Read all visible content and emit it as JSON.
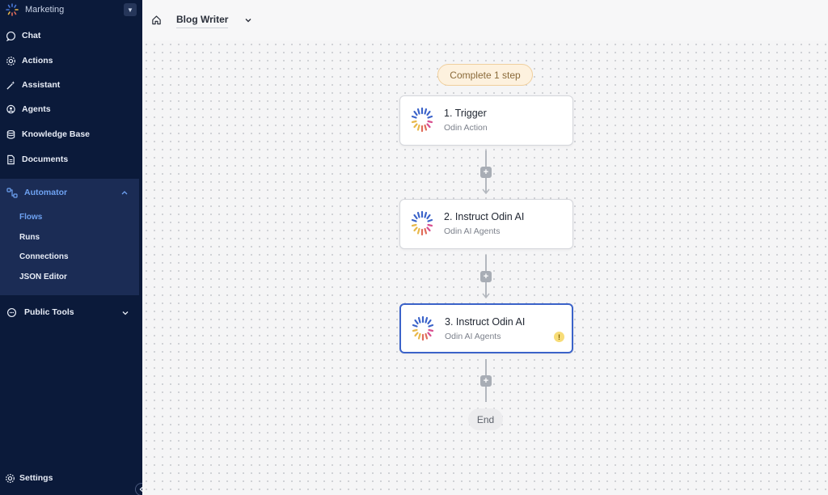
{
  "workspace": {
    "name": "Marketing"
  },
  "nav": {
    "chat": "Chat",
    "actions": "Actions",
    "assistant": "Assistant",
    "agents": "Agents",
    "knowledge_base": "Knowledge Base",
    "documents": "Documents",
    "automator": {
      "label": "Automator",
      "items": [
        "Flows",
        "Runs",
        "Connections",
        "JSON Editor"
      ],
      "active": "Flows"
    },
    "public_tools": "Public Tools",
    "settings": "Settings"
  },
  "topbar": {
    "flow_name": "Blog Writer"
  },
  "canvas": {
    "status": "Complete 1 step",
    "nodes": [
      {
        "title": "1. Trigger",
        "subtitle": "Odin Action"
      },
      {
        "title": "2. Instruct Odin AI",
        "subtitle": "Odin AI Agents"
      },
      {
        "title": "3. Instruct Odin AI",
        "subtitle": "Odin AI Agents",
        "warning": "!"
      }
    ],
    "add_step_label": "+",
    "end_label": "End"
  },
  "colors": {
    "sidebar_bg": "#0b1a3a",
    "sidebar_active_bg": "#1b2c55",
    "accent": "#6ea2f2",
    "selected_border": "#3b63c9",
    "status_bg": "#fdf1de",
    "warning": "#f7dc77"
  },
  "icons": {
    "home": "home-icon",
    "chat": "chat-bubble-icon",
    "actions": "gear-icon",
    "assistant": "magic-wand-icon",
    "agents": "agent-icon",
    "knowledge_base": "database-icon",
    "documents": "document-icon",
    "automator": "flow-nodes-icon",
    "public_tools": "chat-bubble-icon",
    "settings": "gear-icon"
  }
}
